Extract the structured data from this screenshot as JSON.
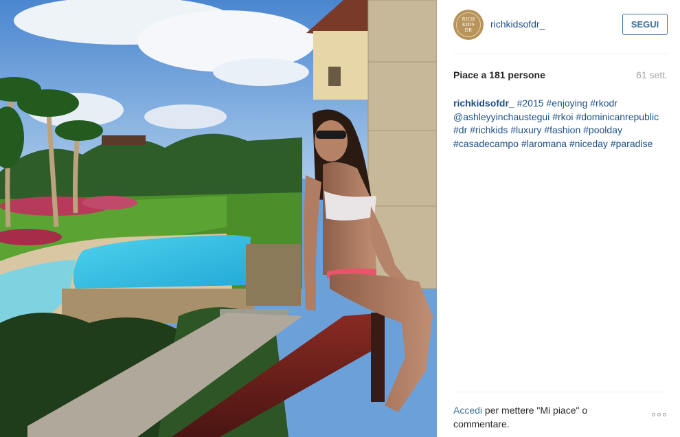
{
  "post": {
    "author": {
      "username": "richkidsofdr_",
      "avatar_text": [
        "RICH",
        "KIDS",
        "DR"
      ]
    },
    "follow_label": "SEGUI",
    "likes": {
      "prefix": "Piace a ",
      "count": "181",
      "suffix": " persone"
    },
    "time_ago": "61 sett.",
    "caption": {
      "username": "richkidsofdr_",
      "hashtags": [
        "#2015",
        "#enjoying",
        "#rkodr",
        "@ashleyyinchaustegui",
        "#rkoi",
        "#dominicanrepublic",
        "#dr",
        "#richkids",
        "#luxury",
        "#fashion",
        "#poolday",
        "#casadecampo",
        "#laromana",
        "#niceday",
        "#paradise"
      ]
    },
    "footer": {
      "login_link": "Accedi",
      "rest": " per mettere \"Mi piace\" o commentare."
    },
    "colors": {
      "link": "#1d4f86",
      "button": "#3f729b",
      "muted": "#a5a7aa"
    },
    "icons": [
      "more-options-icon"
    ]
  }
}
